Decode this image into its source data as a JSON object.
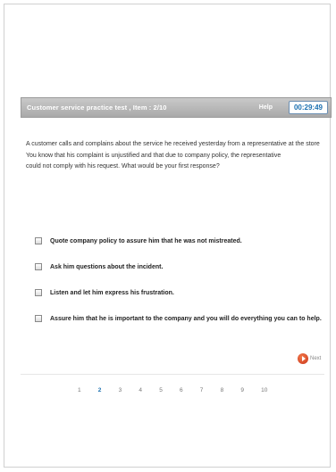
{
  "header": {
    "title": "Customer service practice test , Item : 2/10",
    "help_label": "Help",
    "timer": "00:29:49"
  },
  "question": {
    "lines": [
      "A customer calls and complains about the service he received yesterday from a representative at the store",
      "You know that his complaint is unjustified and that due to company policy, the representative",
      "could not comply with his request. What would be your first response?"
    ]
  },
  "options": [
    {
      "label": "Quote company policy to assure him that he was not mistreated."
    },
    {
      "label": "Ask him questions about the incident."
    },
    {
      "label": "Listen and let him express his frustration."
    },
    {
      "label": "Assure him that he is important to the company and you will do everything you can to help."
    }
  ],
  "navigation": {
    "next_label": "Next"
  },
  "pager": {
    "pages": [
      "1",
      "2",
      "3",
      "4",
      "5",
      "6",
      "7",
      "8",
      "9",
      "10"
    ],
    "current": "2"
  },
  "colors": {
    "accent": "#1a6fb0",
    "header_bg": "#b5b5b5",
    "next_button": "#d9452a"
  }
}
